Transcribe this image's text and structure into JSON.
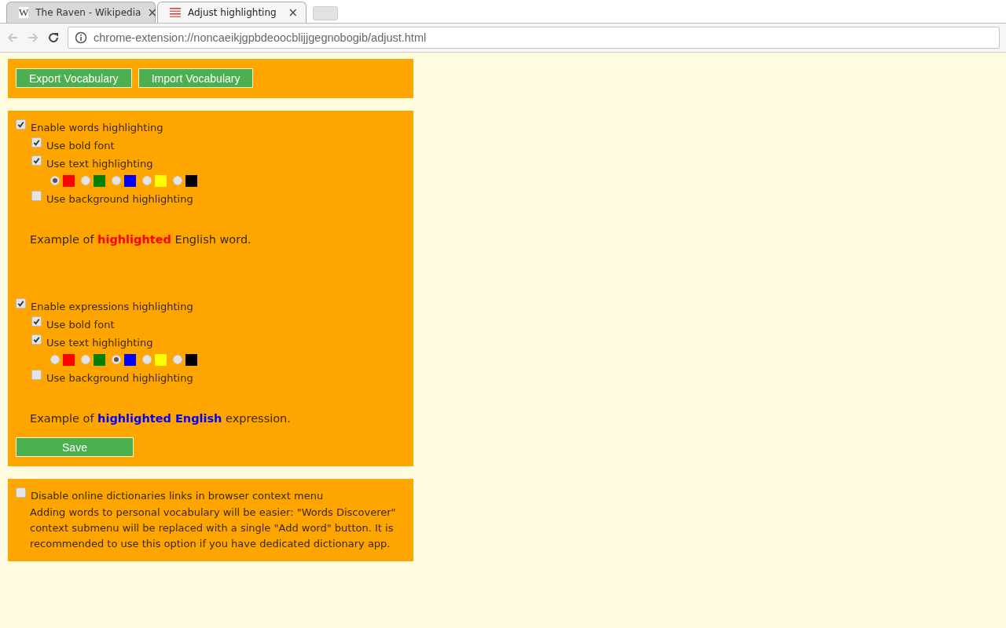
{
  "browser": {
    "tabs": [
      {
        "title": "The Raven - Wikipedia",
        "favicon": "W",
        "selected": false
      },
      {
        "title": "Adjust highlighting",
        "selected": true
      }
    ],
    "close_glyph": "×",
    "address": "chrome-extension://noncaeikjgpbdeoocblijjgegnobogib/adjust.html"
  },
  "vocabulary_buttons": [
    "Export Vocabulary",
    "Import Vocabulary"
  ],
  "sections": [
    {
      "label": "Enable words highlighting",
      "checked": true,
      "use_bold": {
        "label": "Use bold font",
        "checked": true
      },
      "use_text": {
        "label": "Use text highlighting",
        "checked": true
      },
      "swatches": [
        {
          "color": "#ff0000",
          "selected": true
        },
        {
          "color": "#008000",
          "selected": false
        },
        {
          "color": "#0000ff",
          "selected": false
        },
        {
          "color": "#ffff00",
          "selected": false
        },
        {
          "color": "#000000",
          "selected": false
        }
      ],
      "use_background": {
        "label": "Use background highlighting",
        "checked": false
      },
      "example": {
        "before": "Example of ",
        "highlight": "highlighted",
        "after": " English word."
      }
    },
    {
      "label": "Enable expressions highlighting",
      "checked": true,
      "use_bold": {
        "label": "Use bold font",
        "checked": true
      },
      "use_text": {
        "label": "Use text highlighting",
        "checked": true
      },
      "swatches": [
        {
          "color": "#ff0000",
          "selected": false
        },
        {
          "color": "#008000",
          "selected": false
        },
        {
          "color": "#0000ff",
          "selected": true
        },
        {
          "color": "#ffff00",
          "selected": false
        },
        {
          "color": "#000000",
          "selected": false
        }
      ],
      "use_background": {
        "label": "Use background highlighting",
        "checked": false
      },
      "example": {
        "before": "Example of ",
        "highlight": "highlighted English",
        "after": " expression."
      }
    }
  ],
  "save_button": "Save",
  "context_menu": {
    "label": "Disable online dictionaries links in browser context menu",
    "checked": false,
    "note": "Adding words to personal vocabulary will be easier: \"Words Discoverer\" context submenu will be replaced with a single \"Add word\" button. It is recommended to use this option if you have dedicated dictionary app."
  }
}
